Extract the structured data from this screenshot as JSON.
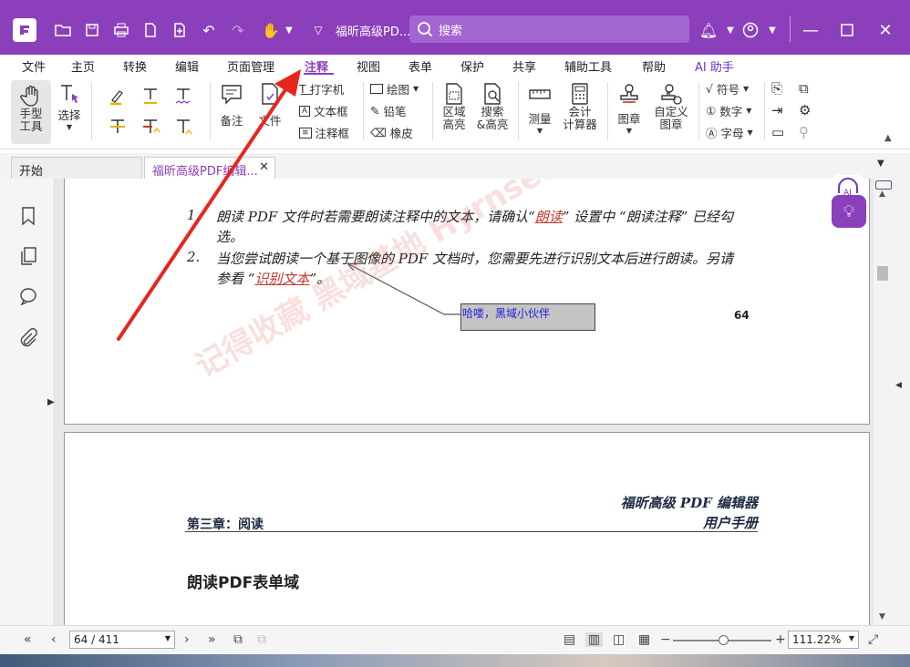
{
  "titlebar": {
    "doc_title": "福昕高级PD...",
    "search_placeholder": "搜索"
  },
  "menu": [
    "文件",
    "主页",
    "转换",
    "编辑",
    "页面管理",
    "注释",
    "视图",
    "表单",
    "保护",
    "共享",
    "辅助工具",
    "帮助",
    "AI 助手"
  ],
  "active_menu": "注释",
  "ribbon": {
    "hand_tool": "手型\n工具",
    "select": "选择",
    "note": "备注",
    "file": "文件",
    "typewriter": "打字机",
    "textbox": "文本框",
    "callout": "注释框",
    "draw": "绘图",
    "pencil": "铅笔",
    "eraser": "橡皮",
    "area_highlight": "区域\n高亮",
    "search_highlight": "搜索\n&高亮",
    "measure": "测量",
    "calculator": "会计\n计算器",
    "stamp": "图章",
    "custom_stamp": "自定义\n图章",
    "symbol": "符号",
    "number": "数字",
    "letter": "字母"
  },
  "tabs": [
    "开始",
    "福昕高级PDF编辑..."
  ],
  "doc": {
    "item1_num": "1.",
    "item1_a": "朗读 PDF 文件时若需要朗读注释中的文本，请确认“",
    "item1_link": "朗读",
    "item1_b": "” 设置中 “朗读注释” 已经勾",
    "item1_c": "选。",
    "item2_num": "2.",
    "item2_a": "当您尝试朗读一个基于图像的 PDF 文档时，您需要先进行识别文本后进行朗读。另请",
    "item2_b": "参看 “",
    "item2_link": "识别文本",
    "item2_c": "”。",
    "callout_text": "哈喽，黑域小伙伴",
    "page_number": "64",
    "header_right1": "福昕高级 PDF 编辑器",
    "header_right2": "用户手册",
    "chapter": "第三章：阅读",
    "section_title": "朗读PDF表单域",
    "watermark": "记得收藏 黑域基地 Hyrnse.com"
  },
  "statusbar": {
    "page": "64 / 411",
    "zoom": "111.22%"
  }
}
